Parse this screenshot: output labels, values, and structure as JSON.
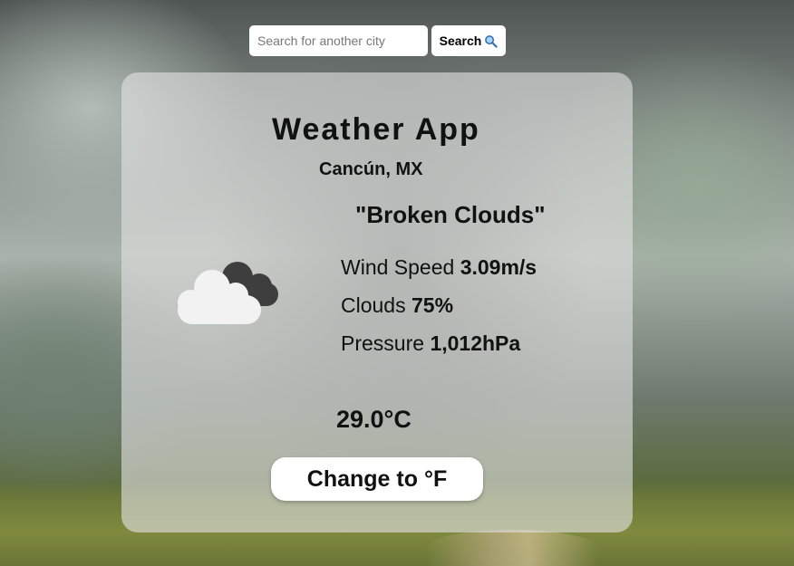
{
  "search": {
    "placeholder": "Search for another city",
    "value": "",
    "button_label": "Search"
  },
  "weather": {
    "app_title": "Weather App",
    "location": "Cancún, MX",
    "description": "\"Broken Clouds\"",
    "icon": "broken-clouds-icon",
    "wind_label": "Wind Speed",
    "wind_value": "3.09m/s",
    "clouds_label": "Clouds",
    "clouds_value": "75%",
    "pressure_label": "Pressure",
    "pressure_value": "1,012hPa",
    "temperature": "29.0°C",
    "unit_button_label": "Change to °F"
  },
  "colors": {
    "card_background": "#e1e1e1",
    "cloud_front": "#f2f2f2",
    "cloud_back": "#404040"
  }
}
